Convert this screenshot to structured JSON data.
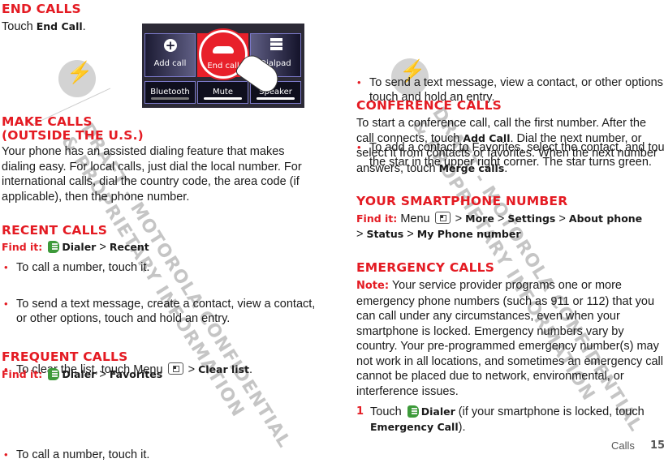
{
  "left": {
    "end_calls": {
      "heading": "End Calls",
      "text_prefix": "Touch ",
      "text_bold": "End Call",
      "text_suffix": "."
    },
    "phone_screen": {
      "buttons": [
        "Add call",
        "End call",
        "Dialpad"
      ],
      "toggles": [
        "Bluetooth",
        "Mute",
        "Speaker"
      ]
    },
    "make_calls": {
      "heading_line1": "Make Calls",
      "heading_line2": "(outside the U.S.)",
      "body": "Your phone has an assisted dialing feature that makes dialing easy. For local calls, just dial the local number. For international calls, dial the country code, the area code (if applicable), then the phone number."
    },
    "recent_calls": {
      "heading": "Recent Calls",
      "find_label": "Find it:",
      "path": [
        "Dialer",
        "Recent"
      ],
      "bullets": [
        "To call a number, touch it.",
        "To send a text message, create a contact, view a contact, or other options, touch and hold an entry."
      ],
      "bullet3_prefix": "To clear the list, touch Menu",
      "bullet3_bold": "Clear list"
    },
    "frequent_calls": {
      "heading": "Frequent Calls",
      "find_label": "Find it:",
      "path": [
        "Dialer",
        "Favorites"
      ],
      "bullets": [
        "To call a number, touch it."
      ]
    }
  },
  "right": {
    "favorites_bullets": [
      "To send a text message, view a contact, or other options, touch and hold an entry.",
      "To add a contact to Favorites, select the contact, and touch the star in the upper right corner. The star turns green."
    ],
    "conference_calls": {
      "heading": "Conference Calls",
      "t1": "To start a conference call, call the first number. After the call connects, touch ",
      "b1": "Add Call",
      "t2": ". Dial the next number, or select it from contacts or favorites. When the next number answers, touch ",
      "b2": "Merge calls",
      "t3": "."
    },
    "smartphone_number": {
      "heading": "Your Smartphone Number",
      "find_label": "Find it:",
      "menu_label": "Menu",
      "path": [
        "More",
        "Settings",
        "About phone",
        "Status",
        "My Phone number"
      ]
    },
    "emergency_calls": {
      "heading": "Emergency Calls",
      "note_label": "Note:",
      "note_text": "Your service provider programs one or more emergency phone numbers (such as 911 or 112) that you can call under any circumstances, even when your smartphone is locked. Emergency numbers vary by country. Your pre-programmed emergency number(s) may not work in all locations, and sometimes an emergency call cannot be placed due to network, environmental, or interference issues.",
      "step_number": "1",
      "step_prefix": "Touch",
      "step_bold1": "Dialer",
      "step_mid": "(if your smartphone is locked, touch",
      "step_bold2": "Emergency Call",
      "step_suffix": ")."
    }
  },
  "watermark": {
    "left_line1": "DRAFT - MOTOROLA CONFIDENTIAL",
    "left_line2": "& PROPRIETARY INFORMATION",
    "right_line1": "DRAFT - MOTOROLA CONFIDENTIAL",
    "right_line2": "& PROPRIETARY INFORMATION"
  },
  "footer": {
    "section": "Calls",
    "page": "15"
  },
  "separator": ">",
  "colors": {
    "heading_red": "#e41b23",
    "dialer_green": "#3d9a3a",
    "end_call_red": "#e8202a"
  }
}
